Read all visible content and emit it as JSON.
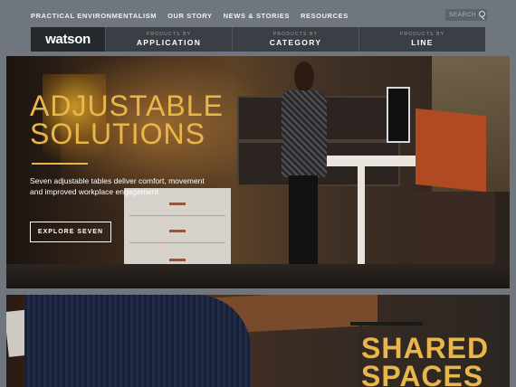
{
  "top_nav": {
    "items": [
      "PRACTICAL ENVIRONMENTALISM",
      "OUR STORY",
      "NEWS & STORIES",
      "RESOURCES"
    ],
    "search_placeholder": "SEARCH"
  },
  "main_nav": {
    "logo": "watson",
    "columns": [
      {
        "prefix": "PRODUCTS BY",
        "label": "APPLICATION"
      },
      {
        "prefix": "PRODUCTS BY",
        "label": "CATEGORY"
      },
      {
        "prefix": "PRODUCTS BY",
        "label": "LINE"
      }
    ]
  },
  "hero": {
    "title_line1": "ADJUSTABLE",
    "title_line2": "SOLUTIONS",
    "description": "Seven adjustable tables deliver comfort, movement and improved workplace engagement.",
    "cta_label": "EXPLORE SEVEN"
  },
  "panel2": {
    "title_line1": "SHARED",
    "title_line2": "SPACES"
  },
  "colors": {
    "accent": "#e8b64b",
    "nav_bg": "#3a3f45",
    "logo_bg": "#25292d",
    "page_bg": "#70767d"
  },
  "icons": {
    "search": "search-icon"
  }
}
